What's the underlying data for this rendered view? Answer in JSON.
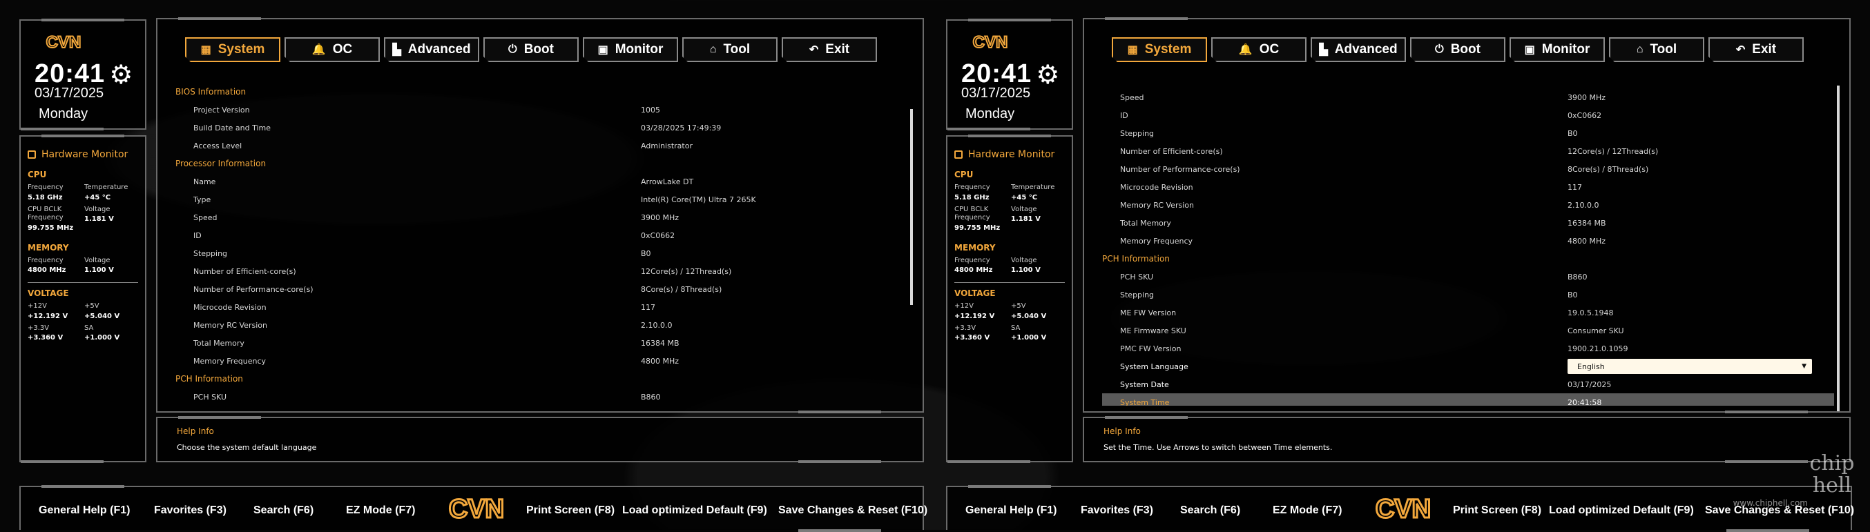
{
  "colors": {
    "accent": "#f3a83c",
    "text": "#ffffff",
    "muted": "#d8d8d8",
    "panel_border": "#6a6a6a",
    "highlight_row": "#5a5a5a"
  },
  "brand": "CVN",
  "clock": {
    "time": "20:41",
    "date": "03/17/2025",
    "day": "Monday",
    "icon": "gear-icon"
  },
  "hardware_monitor": {
    "title": "Hardware Monitor",
    "cpu": {
      "title": "CPU",
      "freq_label": "Frequency",
      "freq_value": "5.18 GHz",
      "temp_label": "Temperature",
      "temp_value": "+45 °C",
      "bclk_label": "CPU BCLK Frequency",
      "bclk_value": "99.755 MHz",
      "volt_label": "Voltage",
      "volt_value": "1.181 V"
    },
    "memory": {
      "title": "MEMORY",
      "freq_label": "Frequency",
      "freq_value": "4800 MHz",
      "volt_label": "Voltage",
      "volt_value": "1.100 V"
    },
    "voltage": {
      "title": "VOLTAGE",
      "v12_label": "+12V",
      "v12_value": "+12.192 V",
      "v5_label": "+5V",
      "v5_value": "+5.040 V",
      "v33_label": "+3.3V",
      "v33_value": "+3.360 V",
      "sa_label": "SA",
      "sa_value": "+1.000 V"
    }
  },
  "tabs": [
    {
      "label": "System",
      "icon": "grid-icon",
      "active": true
    },
    {
      "label": "OC",
      "icon": "rocket-icon"
    },
    {
      "label": "Advanced",
      "icon": "factory-icon"
    },
    {
      "label": "Boot",
      "icon": "power-icon"
    },
    {
      "label": "Monitor",
      "icon": "monitor-icon"
    },
    {
      "label": "Tool",
      "icon": "toolbox-icon"
    },
    {
      "label": "Exit",
      "icon": "back-arrow-icon"
    }
  ],
  "left_panel": {
    "rows": [
      {
        "type": "header",
        "label": "BIOS Information"
      },
      {
        "label": "Project Version",
        "value": "1005"
      },
      {
        "label": "Build Date and Time",
        "value": "03/28/2025 17:49:39"
      },
      {
        "label": "Access Level",
        "value": "Administrator"
      },
      {
        "type": "header",
        "label": "Processor Information"
      },
      {
        "label": "Name",
        "value": "ArrowLake DT"
      },
      {
        "label": "Type",
        "value": "Intel(R) Core(TM) Ultra 7 265K"
      },
      {
        "label": "Speed",
        "value": "3900 MHz"
      },
      {
        "label": "ID",
        "value": "0xC0662"
      },
      {
        "label": "Stepping",
        "value": "B0"
      },
      {
        "label": "Number of Efficient-core(s)",
        "value": "12Core(s) / 12Thread(s)"
      },
      {
        "label": "Number of Performance-core(s)",
        "value": "8Core(s) / 8Thread(s)"
      },
      {
        "label": "Microcode Revision",
        "value": "117"
      },
      {
        "label": "Memory RC Version",
        "value": "2.10.0.0"
      },
      {
        "label": "Total Memory",
        "value": "16384 MB"
      },
      {
        "label": "Memory Frequency",
        "value": "4800 MHz"
      },
      {
        "type": "header",
        "label": "PCH Information"
      },
      {
        "label": "PCH SKU",
        "value": "B860"
      }
    ],
    "help_title": "Help Info",
    "help_text": "Choose the system default language"
  },
  "right_panel": {
    "rows": [
      {
        "label": "Speed",
        "value": "3900 MHz"
      },
      {
        "label": "ID",
        "value": "0xC0662"
      },
      {
        "label": "Stepping",
        "value": "B0"
      },
      {
        "label": "Number of Efficient-core(s)",
        "value": "12Core(s) / 12Thread(s)"
      },
      {
        "label": "Number of Performance-core(s)",
        "value": "8Core(s) / 8Thread(s)"
      },
      {
        "label": "Microcode Revision",
        "value": "117"
      },
      {
        "label": "Memory RC Version",
        "value": "2.10.0.0"
      },
      {
        "label": "Total Memory",
        "value": "16384 MB"
      },
      {
        "label": "Memory Frequency",
        "value": "4800 MHz"
      },
      {
        "type": "header",
        "label": "PCH Information"
      },
      {
        "label": "PCH SKU",
        "value": "B860"
      },
      {
        "label": "Stepping",
        "value": "B0"
      },
      {
        "label": "ME FW Version",
        "value": "19.0.5.1948"
      },
      {
        "label": "ME Firmware SKU",
        "value": "Consumer SKU"
      },
      {
        "label": "PMC FW Version",
        "value": "1900.21.0.1059"
      },
      {
        "label": "System Language",
        "value": "English",
        "type": "select"
      },
      {
        "label": "System Date",
        "value": "03/17/2025",
        "type": "interactive"
      },
      {
        "label": "System Time",
        "value": "20:41:58",
        "type": "highlight"
      }
    ],
    "help_title": "Help Info",
    "help_text": "Set the Time. Use Arrows to switch between Time elements."
  },
  "footer": {
    "general_help": "General Help (F1)",
    "favorites": "Favorites (F3)",
    "search": "Search (F6)",
    "ez_mode": "EZ Mode (F7)",
    "print_screen": "Print Screen (F8)",
    "load_default": "Load optimized Default (F9)",
    "save_reset": "Save Changes & Reset (F10)"
  },
  "watermark": {
    "text": "chip hell",
    "url": "www.chiphell.com"
  }
}
